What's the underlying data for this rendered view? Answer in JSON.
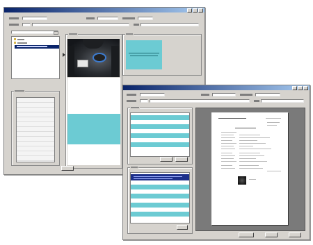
{
  "colors": {
    "title_bar_start": "#0a246a",
    "title_bar_end": "#a6caf0",
    "window_face": "#d6d3ce",
    "stripe_teal": "#6ccbd3",
    "selection": "#0a246a",
    "preview_background": "#7a7a7a"
  },
  "icons": {
    "tree_folder": "folder-icon",
    "list_row_marker": "arrow-right-icon",
    "document_thumbnail": "document-page-icon"
  }
}
